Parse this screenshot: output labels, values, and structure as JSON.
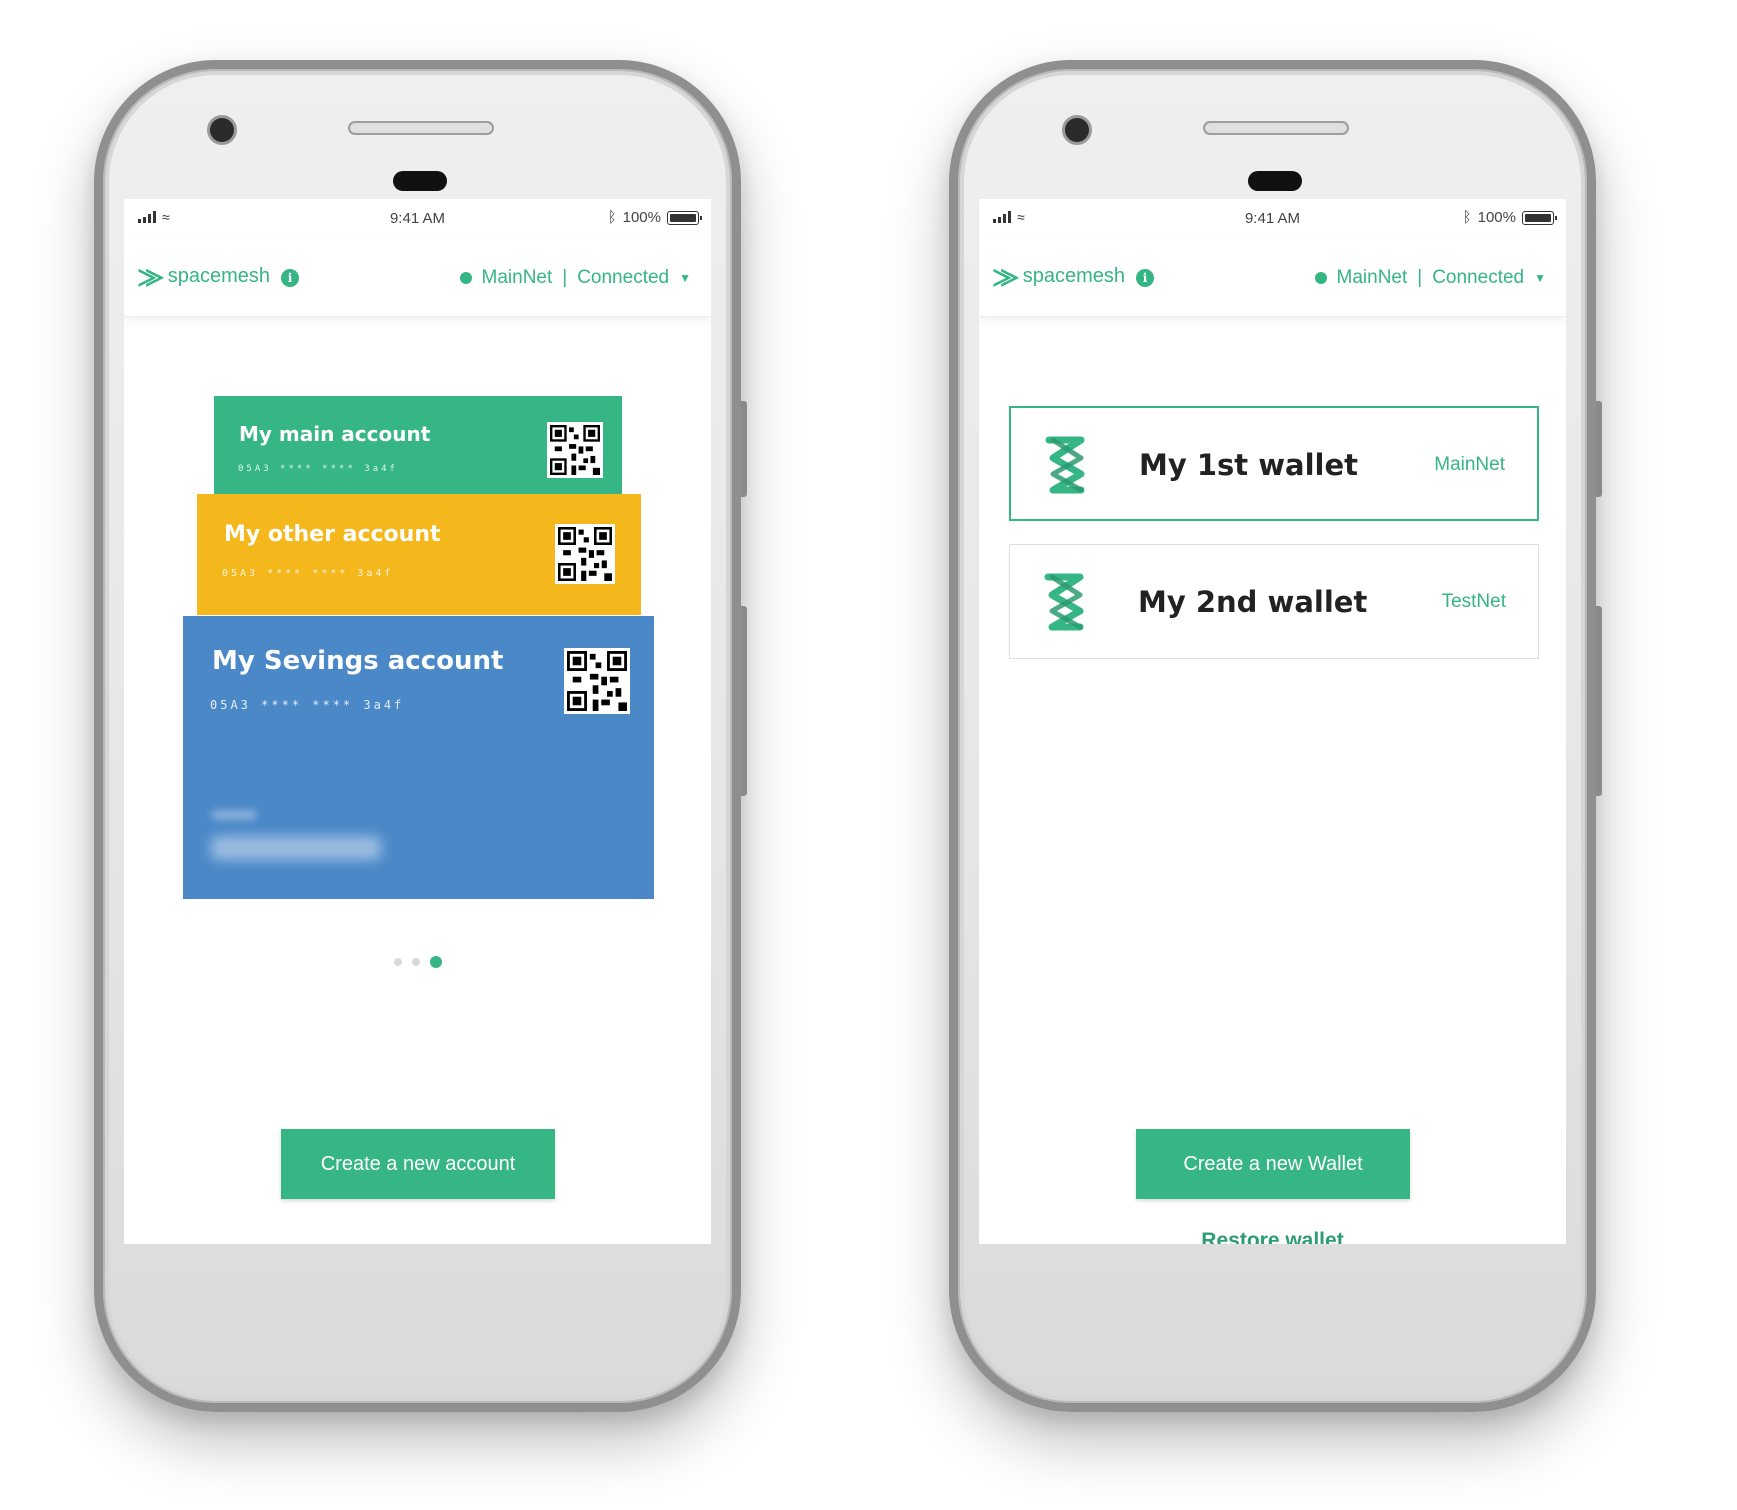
{
  "status_bar": {
    "time": "9:41 AM",
    "battery": "100%",
    "bluetooth_icon": "bluetooth-icon"
  },
  "app_bar": {
    "logo_text": "spacemesh",
    "network": "MainNet",
    "separator": "|",
    "connection": "Connected"
  },
  "accounts_screen": {
    "cards": [
      {
        "title": "My main account",
        "number": "05A3 **** **** 3a4f",
        "color": "#36b585"
      },
      {
        "title": "My other account",
        "number": "05A3 **** **** 3a4f",
        "color": "#f4b81c"
      },
      {
        "title": "My Sevings account",
        "number": "05A3 **** **** 3a4f",
        "color": "#4a88c8"
      }
    ],
    "pager": {
      "count": 3,
      "active": 3
    },
    "create_button": "Create a new account"
  },
  "wallets_screen": {
    "wallets": [
      {
        "name": "My 1st wallet",
        "network": "MainNet",
        "selected": true
      },
      {
        "name": "My 2nd wallet",
        "network": "TestNet",
        "selected": false
      }
    ],
    "create_button": "Create a new Wallet",
    "restore_link": "Restore wallet"
  },
  "colors": {
    "accent": "#35b584",
    "yellow": "#f4b81c",
    "blue": "#4a88c8"
  }
}
